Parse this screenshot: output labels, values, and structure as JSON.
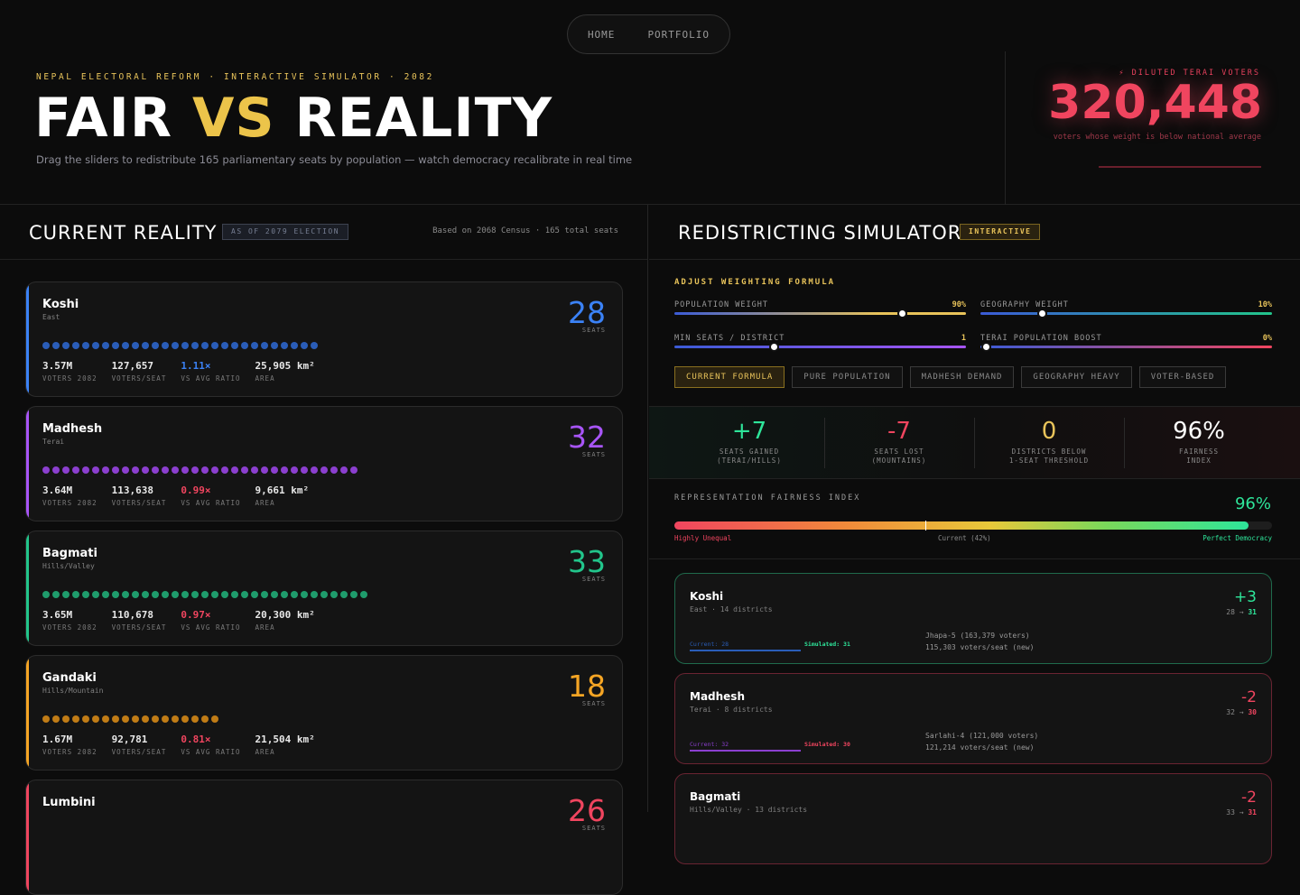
{
  "nav": {
    "home": "HOME",
    "portfolio": "PORTFOLIO"
  },
  "header": {
    "eyebrow": "NEPAL ELECTORAL REFORM · INTERACTIVE SIMULATOR · 2082",
    "title_part1": "FAIR",
    "title_vs": "VS",
    "title_part2": "REALITY",
    "subtitle": "Drag the sliders to redistribute 165 parliamentary seats by population — watch democracy recalibrate in real time",
    "diluted_label": "⚡ DILUTED TERAI VOTERS",
    "diluted_value": "320,448",
    "diluted_sub": "voters whose weight is below national average"
  },
  "current": {
    "title": "CURRENT REALITY",
    "tag": "AS OF 2079 ELECTION",
    "census": "Based on 2068 Census · 165 total seats",
    "seats_label": "SEATS",
    "stat_labels": [
      "VOTERS 2082",
      "VOTERS/SEAT",
      "VS AVG RATIO",
      "AREA"
    ],
    "provinces": [
      {
        "name": "Koshi",
        "region": "East",
        "seats": "28",
        "seat_count": 28,
        "color": "#3b82f6",
        "dot_color": "#2a5db8",
        "voters": "3.57M",
        "per_seat": "127,657",
        "ratio": "1.11×",
        "ratio_color": "#3b82f6",
        "area": "25,905 km²"
      },
      {
        "name": "Madhesh",
        "region": "Terai",
        "seats": "32",
        "seat_count": 32,
        "color": "#a855f7",
        "dot_color": "#8b3fcf",
        "voters": "3.64M",
        "per_seat": "113,638",
        "ratio": "0.99×",
        "ratio_color": "#f0455f",
        "area": "9,661 km²"
      },
      {
        "name": "Bagmati",
        "region": "Hills/Valley",
        "seats": "33",
        "seat_count": 33,
        "color": "#22c58b",
        "dot_color": "#1f9c6c",
        "voters": "3.65M",
        "per_seat": "110,678",
        "ratio": "0.97×",
        "ratio_color": "#f0455f",
        "area": "20,300 km²"
      },
      {
        "name": "Gandaki",
        "region": "Hills/Mountain",
        "seats": "18",
        "seat_count": 18,
        "color": "#f5a524",
        "dot_color": "#c07c16",
        "voters": "1.67M",
        "per_seat": "92,781",
        "ratio": "0.81×",
        "ratio_color": "#f0455f",
        "area": "21,504 km²"
      },
      {
        "name": "Lumbini",
        "region": "",
        "seats": "26",
        "seat_count": 0,
        "color": "#f0455f",
        "dot_color": "#c03048",
        "voters": "",
        "per_seat": "",
        "ratio": "",
        "ratio_color": "#f0455f",
        "area": ""
      }
    ]
  },
  "simulator": {
    "title": "REDISTRICTING SIMULATOR",
    "tag": "INTERACTIVE",
    "adjust_title": "ADJUST WEIGHTING FORMULA",
    "sliders": [
      {
        "label": "POPULATION WEIGHT",
        "value": "90%",
        "level": 0.78
      },
      {
        "label": "GEOGRAPHY WEIGHT",
        "value": "10%",
        "level": 0.21
      },
      {
        "label": "MIN SEATS / DISTRICT",
        "value": "1",
        "level": 0.34
      },
      {
        "label": "TERAI POPULATION BOOST",
        "value": "0%",
        "level": 0.02
      }
    ],
    "presets": [
      "CURRENT FORMULA",
      "PURE POPULATION",
      "MADHESH DEMAND",
      "GEOGRAPHY HEAVY",
      "VOTER-BASED"
    ],
    "metrics": [
      {
        "value": "+7",
        "label": "SEATS GAINED\n(TERAI/HILLS)",
        "color": "#2ee59a"
      },
      {
        "value": "-7",
        "label": "SEATS LOST\n(MOUNTAINS)",
        "color": "#f0455f"
      },
      {
        "value": "0",
        "label": "DISTRICTS BELOW\n1-SEAT THRESHOLD",
        "color": "#e8c35a"
      },
      {
        "value": "96%",
        "label": "FAIRNESS\nINDEX",
        "color": "#ffffff"
      }
    ],
    "fairness": {
      "label": "REPRESENTATION FAIRNESS INDEX",
      "value": "96%",
      "level": 0.96,
      "current_level": 0.42,
      "low": "Highly Unequal",
      "current": "Current (42%)",
      "high": "Perfect Democracy"
    },
    "results": [
      {
        "name": "Koshi",
        "region": "East · 14 districts",
        "delta": "+3",
        "from": "28",
        "to": "31",
        "current": "Current: 28",
        "simulated": "Simulated: 31",
        "note1": "Jhapa-5 (163,379 voters)",
        "note2": "115,303 voters/seat (new)",
        "accent": "#2ee59a",
        "border": "#1f6a4c",
        "line": "#2a5db8"
      },
      {
        "name": "Madhesh",
        "region": "Terai · 8 districts",
        "delta": "-2",
        "from": "32",
        "to": "30",
        "current": "Current: 32",
        "simulated": "Simulated: 30",
        "note1": "Sarlahi-4 (121,000 voters)",
        "note2": "121,214 voters/seat (new)",
        "accent": "#f0455f",
        "border": "#6a2432",
        "line": "#8b3fcf"
      },
      {
        "name": "Bagmati",
        "region": "Hills/Valley · 13 districts",
        "delta": "-2",
        "from": "33",
        "to": "31",
        "current": "",
        "simulated": "",
        "note1": "",
        "note2": "",
        "accent": "#f0455f",
        "border": "#6a2432",
        "line": "#1f9c6c"
      }
    ]
  }
}
